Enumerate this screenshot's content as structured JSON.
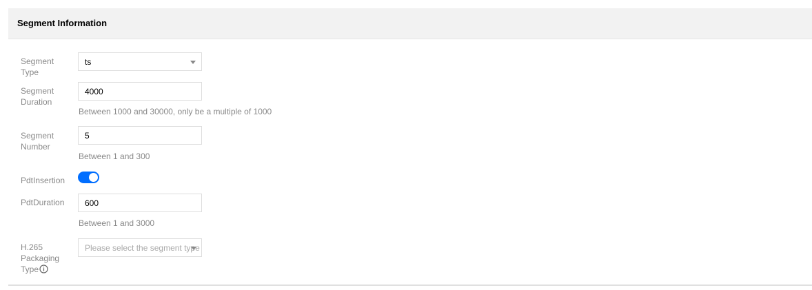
{
  "section": {
    "title": "Segment Information"
  },
  "form": {
    "segment_type": {
      "label": "Segment Type",
      "value": "ts"
    },
    "segment_duration": {
      "label": "Segment Duration",
      "value": "4000",
      "hint": "Between 1000 and 30000, only be a multiple of 1000"
    },
    "segment_number": {
      "label": "Segment Number",
      "value": "5",
      "hint": "Between 1 and 300"
    },
    "pdt_insertion": {
      "label": "PdtInsertion",
      "enabled": true
    },
    "pdt_duration": {
      "label": "PdtDuration",
      "value": "600",
      "hint": "Between 1 and 3000"
    },
    "h265_packaging_type": {
      "label": "H.265 Packaging Type",
      "placeholder": "Please select the segment type",
      "icon": "info-icon"
    }
  },
  "colors": {
    "accent": "#006eff",
    "header_background": "#f2f2f2",
    "label_text": "#888888"
  }
}
